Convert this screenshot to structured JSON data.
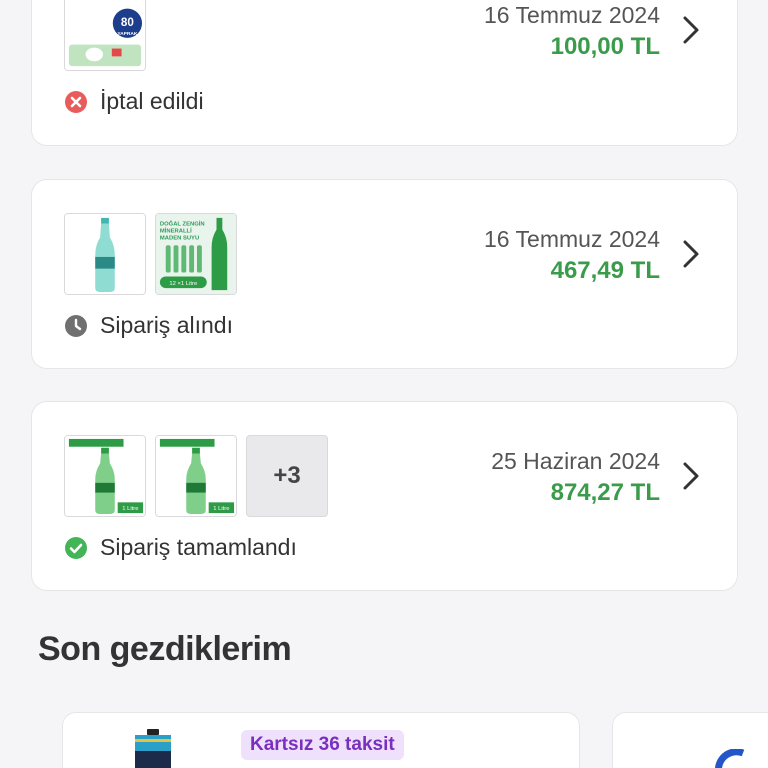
{
  "orders": [
    {
      "date": "16 Temmuz 2024",
      "price": "100,00 TL",
      "status": "İptal edildi",
      "status_type": "cancelled",
      "thumbnail_badge": "80",
      "thumbnail_badge_sub": "YAPRAK"
    },
    {
      "date": "16 Temmuz 2024",
      "price": "467,49 TL",
      "status": "Sipariş alındı",
      "status_type": "received",
      "thumbnail_text": [
        "DOĞAL ZENGİN",
        "MİNERALLİ",
        "MADEN SUYU"
      ],
      "thumbnail_caption": "12 ×1 Litre"
    },
    {
      "date": "25 Haziran 2024",
      "price": "874,27 TL",
      "status": "Sipariş tamamlandı",
      "status_type": "completed",
      "thumbnail_caption": "1 Litre",
      "more_count": "+3"
    }
  ],
  "recent_section": {
    "title": "Son gezdiklerim",
    "products": [
      {
        "badge": "Kartsız 36 taksit"
      },
      {
        "badge": ""
      }
    ]
  },
  "colors": {
    "price_green": "#3a9b4a",
    "cancel_red": "#e85c5c",
    "received_gray": "#707070",
    "completed_green": "#43b556",
    "promo_purple": "#7b2fbf"
  }
}
